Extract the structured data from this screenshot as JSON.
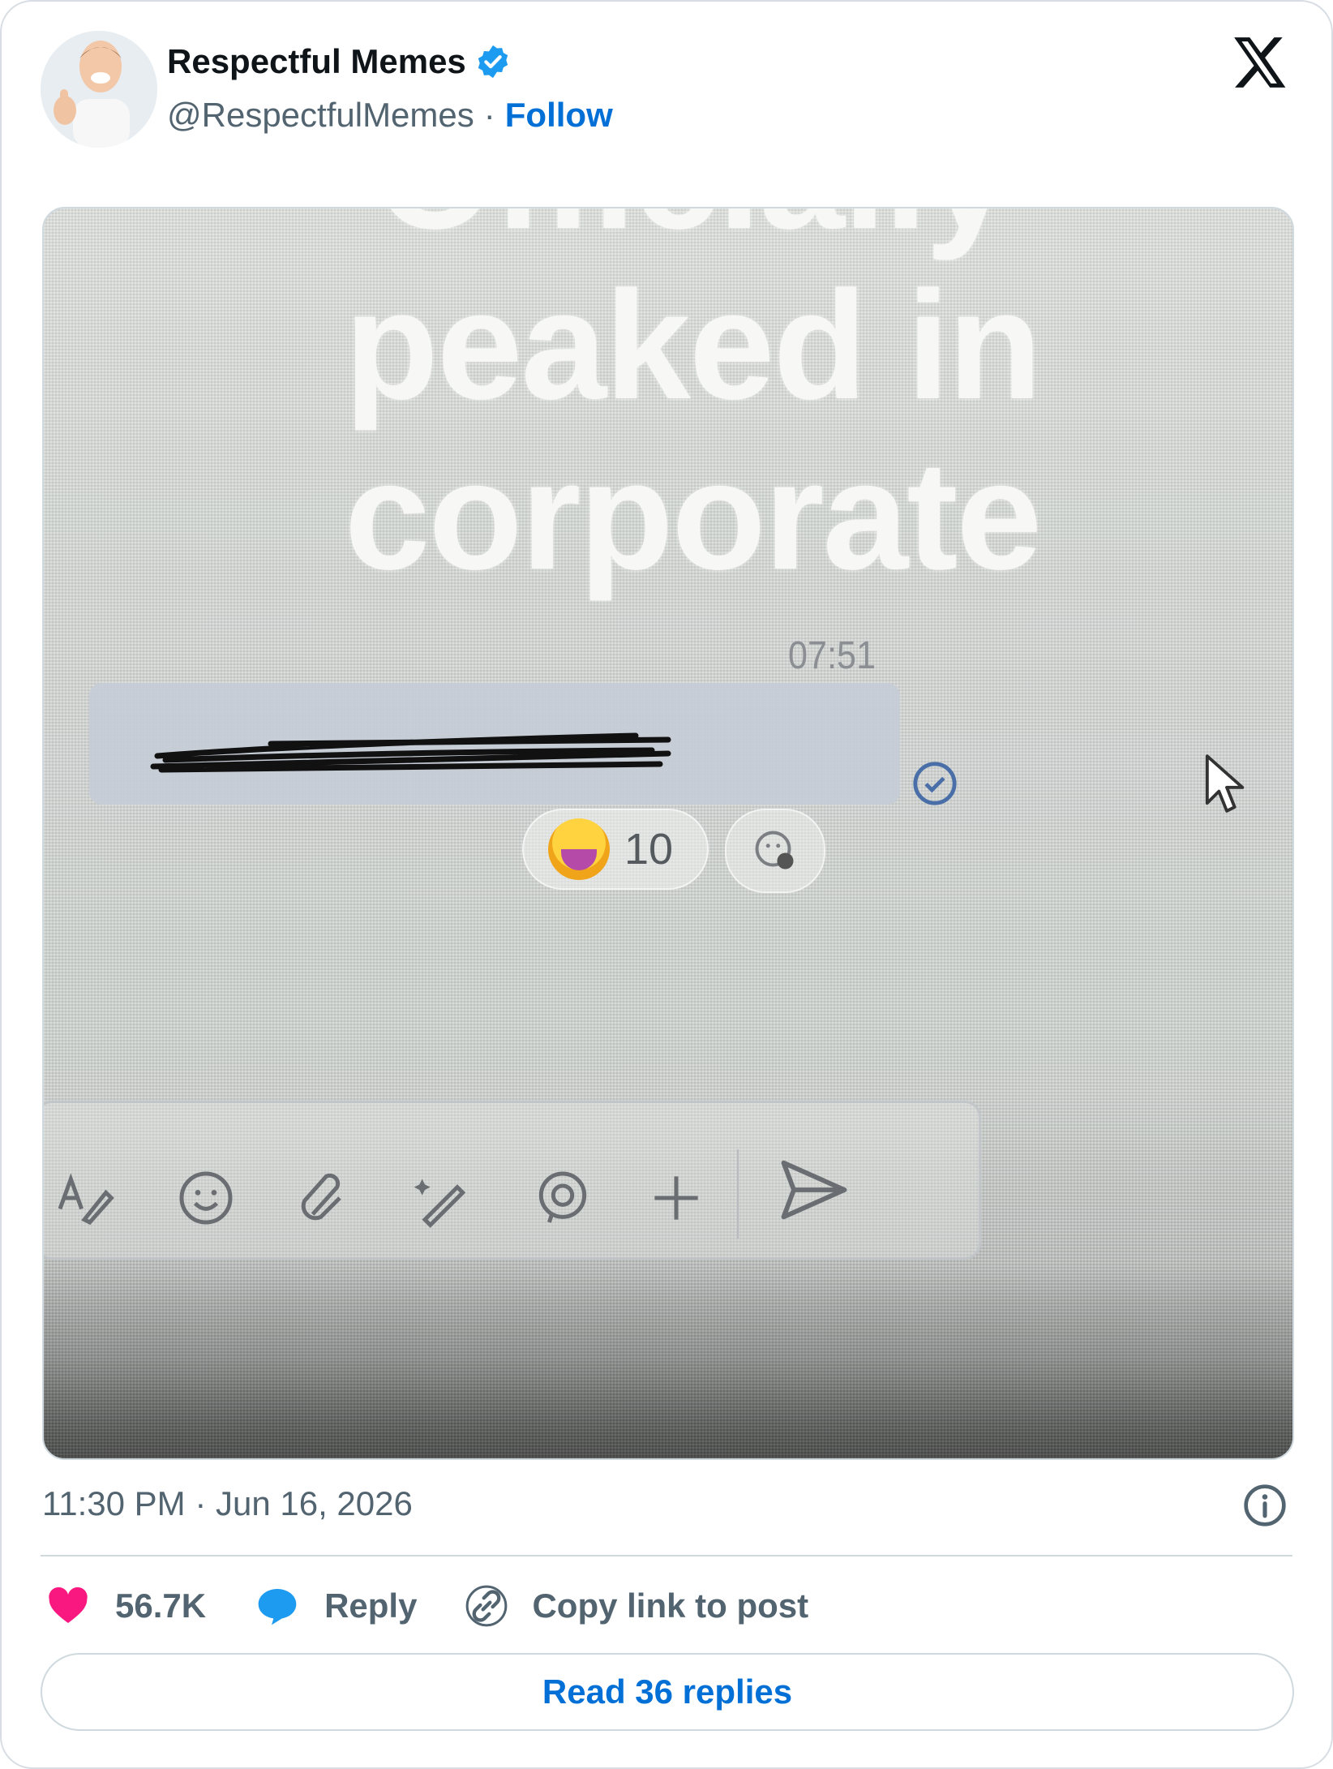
{
  "post": {
    "author_name": "Respectful Memes",
    "handle": "@RespectfulMemes",
    "separator": "·",
    "follow_label": "Follow",
    "verified": true,
    "timestamp": "11:30 PM · Jun 16, 2026"
  },
  "media": {
    "caption_top_partial": "Officially",
    "caption_line1": "peaked in",
    "caption_line2": "corporate",
    "message_time": "07:51",
    "reaction_emoji": "laughing-face-emoji",
    "reaction_count": "10",
    "toolbar_icons": [
      "format-text-icon",
      "emoji-icon",
      "attach-icon",
      "ai-sparkle-pen-icon",
      "loop-icon",
      "plus-icon",
      "send-icon"
    ]
  },
  "actions": {
    "likes_count": "56.7K",
    "reply_label": "Reply",
    "copy_link_label": "Copy link to post",
    "read_replies_label": "Read 36 replies"
  },
  "colors": {
    "accent": "#006fd6",
    "like": "#f91880",
    "reply_icon": "#1d9bf0",
    "muted": "#536471"
  }
}
